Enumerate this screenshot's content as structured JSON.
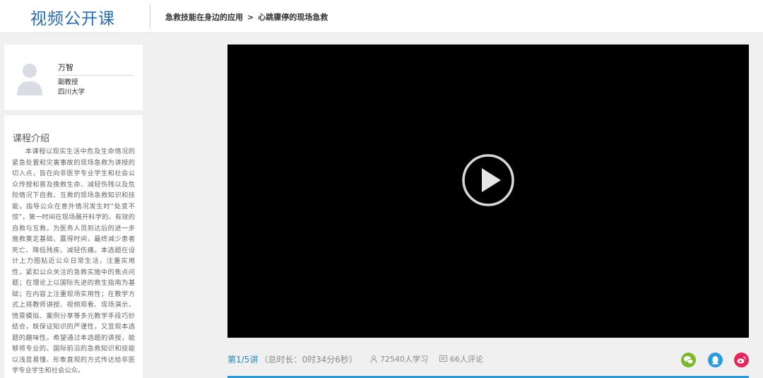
{
  "header": {
    "logo": "视频公开课",
    "breadcrumb": {
      "course": "急救技能在身边的应用",
      "separator": ">",
      "lesson": "心跳骤停的现场急救"
    }
  },
  "teacher": {
    "name": "万智",
    "title": "副教授",
    "school": "四川大学"
  },
  "intro": {
    "title": "课程介绍",
    "text": "本课程以现实生活中危及生命情况的紧急处置和灾害事故的现场急救为讲授的切入点，旨在向非医学专业学生和社会公众传授和普及挽救生命、减轻伤残以及危险情况下自救、互救的现场急救知识和技能，指导公众在意外情况发生时“处变不惊”，第一时间在现场展开科学的、有效的自救与互救，为医务人员到达后的进一步施救奠定基础、赢得时间，最终减少患者死亡、降低残疾、减轻伤痛。本选题在设计上力图贴近公众日常生活，注重实用性，紧扣公众关注的急救实施中的焦点问题；在理论上以国际先进的救生指南为基础；在内容上注重现场实用性；在教学方式上将教师讲授、视频观看、现场演示、情景模拟、案例分享等多元教学手段巧妙结合，既保证知识的严谨性，又显现本选题的趣味性。希望通过本选题的讲授，能够将专业的、国际前沿的急救知识和技能以浅显易懂、形象直观的方式传达给非医学专业学生和社会公众。"
  },
  "player": {
    "play_icon": "play-circle-icon"
  },
  "info": {
    "lesson": "第1/5讲",
    "duration": "（总时长：0时34分6秒）",
    "learners": "72540人学习",
    "comments": "66人评论"
  },
  "share": {
    "icons": [
      "wechat-icon",
      "qq-icon",
      "weibo-icon"
    ]
  },
  "colors": {
    "brand": "#2a6bb3",
    "accent": "#1f87c7",
    "wechat": "#7bb82d",
    "qq": "#2b9be0",
    "weibo": "#e8245a"
  }
}
